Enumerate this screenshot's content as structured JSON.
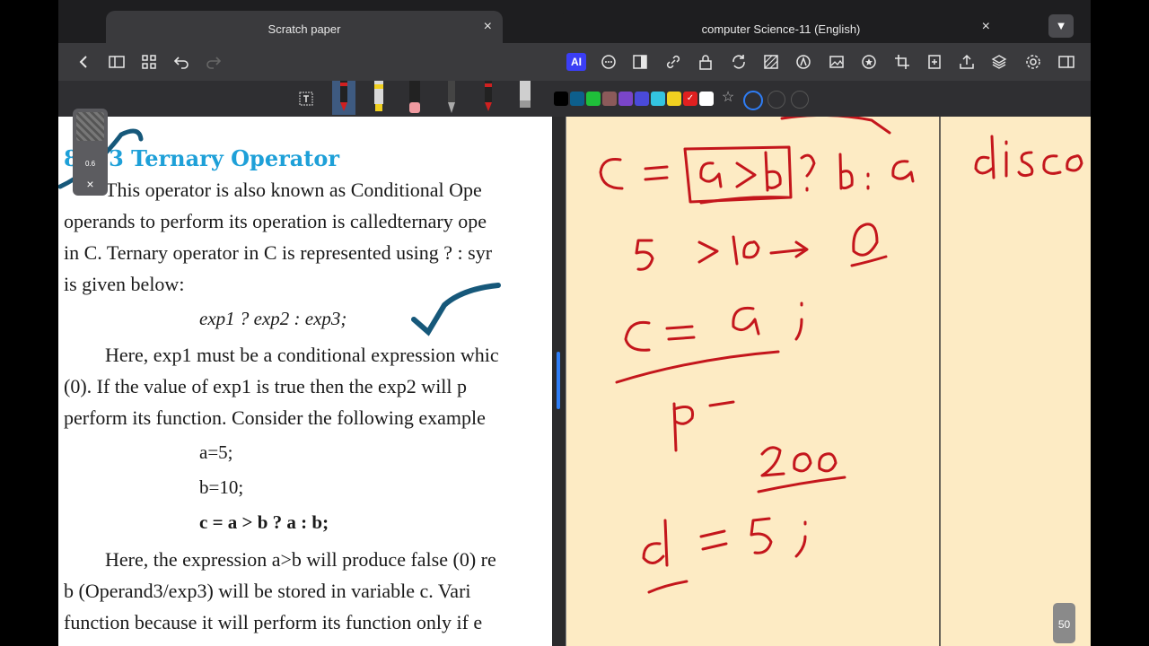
{
  "tabs": [
    {
      "title": "Scratch paper",
      "close_label": "×"
    },
    {
      "title": "computer Science-11 (English)",
      "close_label": "×"
    }
  ],
  "tab_dropdown_icon": "▼",
  "toolbar": {
    "left_icons": [
      "back-icon",
      "sidebar-icon",
      "grid-icon",
      "undo-icon",
      "redo-icon"
    ],
    "right_icons": [
      "ai-icon",
      "chat-icon",
      "page-view-icon",
      "link-icon",
      "lock-icon",
      "sync-icon",
      "pattern-icon",
      "shape-icon",
      "image-icon",
      "sticker-icon",
      "crop-icon",
      "add-page-icon",
      "export-icon",
      "layers-icon",
      "settings-icon",
      "panel-icon"
    ],
    "ai_label": "AI"
  },
  "pen_widget": {
    "size": "0.6",
    "close": "×"
  },
  "palette": [
    "#000000",
    "#0d5f8c",
    "#1fbf3a",
    "#8b5a5a",
    "#7a45c9",
    "#4a4ad9",
    "#33c3e0",
    "#f0d020",
    "#e02020",
    "#ffffff"
  ],
  "document": {
    "heading": "8.1.3 Ternary Operator",
    "lines": [
      "This operator is also known as Conditional Ope",
      "operands to perform its operation is calledternary ope",
      "in C. Ternary operator in C is represented using ? : syr",
      "is given below:"
    ],
    "syntax": "exp1 ? exp2 : exp3;",
    "para2": [
      "Here, exp1 must be a conditional expression whic",
      "(0). If the value of exp1 is true then the exp2 will p",
      "perform its function. Consider the following example"
    ],
    "code": [
      "a=5;",
      "b=10;",
      "c = a > b  ?  a  :  b;"
    ],
    "para3": [
      "Here, the expression a>b will produce false (0) re",
      "b (Operand3/exp3) will be stored in variable c. Vari",
      "function because it will perform its function only if e"
    ]
  },
  "page_number": "50"
}
